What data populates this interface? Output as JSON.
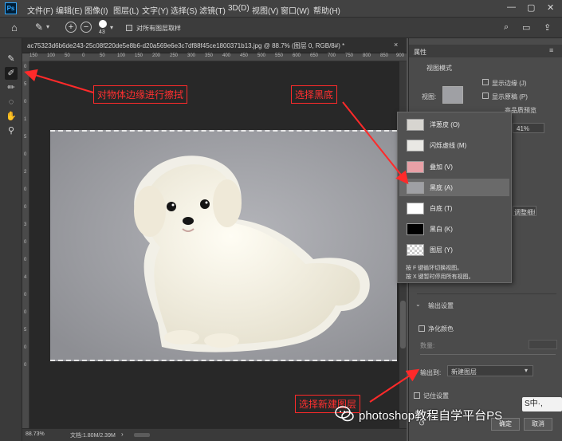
{
  "menubar": {
    "logo": "Ps",
    "items": [
      "文件(F)",
      "编辑(E)",
      "图像(I)",
      "图层(L)",
      "文字(Y)",
      "选择(S)",
      "滤镜(T)",
      "3D(D)",
      "视图(V)",
      "窗口(W)",
      "帮助(H)"
    ]
  },
  "options": {
    "brush_size": "43",
    "sample_all_label": "对所有图层取样"
  },
  "document": {
    "tab_title": "ac75323d6b6de243-25c08f220de5e8b6-d20a569e6e3c7df88f45ce1800371b13.jpg @ 88.7% (图层 0, RGB/8#) *",
    "ruler_h": [
      "150",
      "100",
      "50",
      "0",
      "50",
      "100",
      "150",
      "200",
      "250",
      "300",
      "350",
      "400",
      "450",
      "500",
      "550",
      "600",
      "650",
      "700",
      "750",
      "800",
      "850",
      "900"
    ],
    "ruler_v": [
      "0",
      "5",
      "0",
      "1",
      "5",
      "0",
      "2",
      "0",
      "0",
      "3",
      "0",
      "0",
      "4",
      "0",
      "0",
      "5",
      "0",
      "0"
    ]
  },
  "status": {
    "zoom": "88.73%",
    "doc_size": "文档:1.80M/2.39M"
  },
  "properties": {
    "tab": "属性",
    "view_mode_heading": "视图模式",
    "view_label": "视图:",
    "show_edge": "显示边缘 (J)",
    "show_original": "显示原稿 (P)",
    "realtime_preview": "高品质预览",
    "opacity_value": "41%",
    "refine": "调整细线",
    "output_heading": "输出设置",
    "decontaminate": "净化颜色",
    "amount_label": "数量:",
    "output_to_label": "输出到:",
    "output_to_value": "新建图层",
    "remember": "记住设置",
    "ok": "确定",
    "cancel": "取消"
  },
  "view_popup": {
    "items": [
      {
        "label": "洋葱皮 (O)",
        "selected": false,
        "thumb_color": "#d7d5d0"
      },
      {
        "label": "闪烁虚线 (M)",
        "selected": false,
        "thumb_color": "#e9e8e4"
      },
      {
        "label": "叠加 (V)",
        "selected": false,
        "thumb_color": "#e8a0a6"
      },
      {
        "label": "黑底 (A)",
        "selected": true,
        "thumb_color": "#9fa0a4"
      },
      {
        "label": "白底 (T)",
        "selected": false,
        "thumb_color": "#ffffff"
      },
      {
        "label": "黑白 (K)",
        "selected": false,
        "thumb_color": "#000000"
      },
      {
        "label": "图层 (Y)",
        "selected": false,
        "thumb_color": "#d8d8d8"
      }
    ],
    "hint1": "按 F 键循环切换视图。",
    "hint2": "按 X 键暂时停用所有视图。"
  },
  "annotations": {
    "erase_edge": "对物体边缘进行擦拭",
    "choose_black": "选择黑底",
    "choose_new_layer": "选择新建图层"
  },
  "watermark": {
    "text": "photoshop教程自学平台PS",
    "ime": "S中·,"
  },
  "colors": {
    "accent_red": "#ff2a2a",
    "ps_blue": "#31a8ff"
  }
}
